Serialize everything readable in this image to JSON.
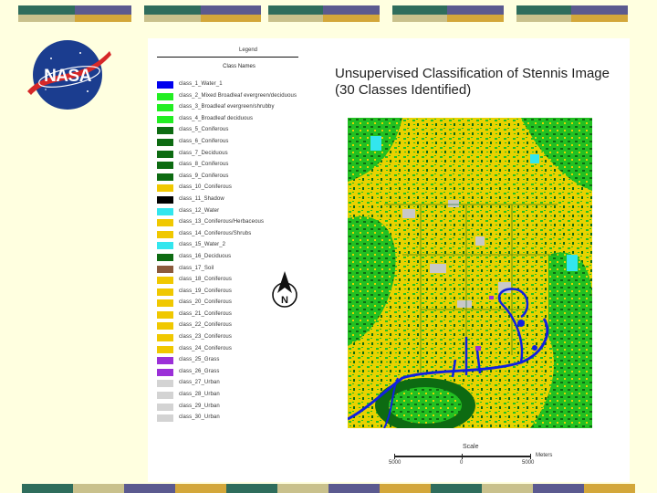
{
  "slide": {
    "title_lines": [
      "Unsupervised Classification of Stennis Image",
      "(30 Classes Identified)"
    ],
    "logo_text": "NASA",
    "colors": {
      "background": "#ffffe0",
      "bar_green": "#2f6d5c",
      "bar_tan": "#c9c18c",
      "bar_gold": "#d3a73a",
      "bar_navy": "#5b5a8f"
    }
  },
  "legend": {
    "title": "Legend",
    "subtitle": "Class Names",
    "items": [
      {
        "label": "class_1_Water_1",
        "color": "#0000ee"
      },
      {
        "label": "class_2_Mixed Broadleaf evergreen/deciduous",
        "color": "#22ee22"
      },
      {
        "label": "class_3_Broadleaf evergreen/shrubby",
        "color": "#22ee22"
      },
      {
        "label": "class_4_Broadleaf deciduous",
        "color": "#22ee22"
      },
      {
        "label": "class_5_Coniferous",
        "color": "#0d6b12"
      },
      {
        "label": "class_6_Coniferous",
        "color": "#0d6b12"
      },
      {
        "label": "class_7_Deciduous",
        "color": "#0d6b12"
      },
      {
        "label": "class_8_Coniferous",
        "color": "#0d6b12"
      },
      {
        "label": "class_9_Coniferous",
        "color": "#0d6b12"
      },
      {
        "label": "class_10_Coniferous",
        "color": "#f0c800"
      },
      {
        "label": "class_11_Shadow",
        "color": "#000000"
      },
      {
        "label": "class_12_Water",
        "color": "#33e6ee"
      },
      {
        "label": "class_13_Coniferous/Herbaceous",
        "color": "#f0c800"
      },
      {
        "label": "class_14_Coniferous/Shrubs",
        "color": "#f0c800"
      },
      {
        "label": "class_15_Water_2",
        "color": "#33e6ee"
      },
      {
        "label": "class_16_Deciduous",
        "color": "#0d6b12"
      },
      {
        "label": "class_17_Soil",
        "color": "#8b5a3c"
      },
      {
        "label": "class_18_Coniferous",
        "color": "#f0c800"
      },
      {
        "label": "class_19_Coniferous",
        "color": "#f0c800"
      },
      {
        "label": "class_20_Coniferous",
        "color": "#f0c800"
      },
      {
        "label": "class_21_Coniferous",
        "color": "#f0c800"
      },
      {
        "label": "class_22_Coniferous",
        "color": "#f0c800"
      },
      {
        "label": "class_23_Coniferous",
        "color": "#f0c800"
      },
      {
        "label": "class_24_Coniferous",
        "color": "#f0c800"
      },
      {
        "label": "class_25_Grass",
        "color": "#9b30d8"
      },
      {
        "label": "class_26_Grass",
        "color": "#9b30d8"
      },
      {
        "label": "class_27_Urban",
        "color": "#d3d3d3"
      },
      {
        "label": "class_28_Urban",
        "color": "#d3d3d3"
      },
      {
        "label": "class_29_Urban",
        "color": "#d3d3d3"
      },
      {
        "label": "class_30_Urban",
        "color": "#d3d3d3"
      }
    ]
  },
  "north_arrow": {
    "letter": "N"
  },
  "scale": {
    "title": "Scale",
    "labels": [
      "5000",
      "0",
      "5000"
    ],
    "unit": "Meters"
  },
  "map": {
    "icon": "classified-satellite-image",
    "colors": {
      "yellow": "#e8d200",
      "green": "#22c022",
      "dark_green": "#0d6b12",
      "blue": "#1020e0",
      "cyan": "#33e6ee",
      "gray": "#c8c8c8",
      "purple": "#9b30d8"
    }
  }
}
